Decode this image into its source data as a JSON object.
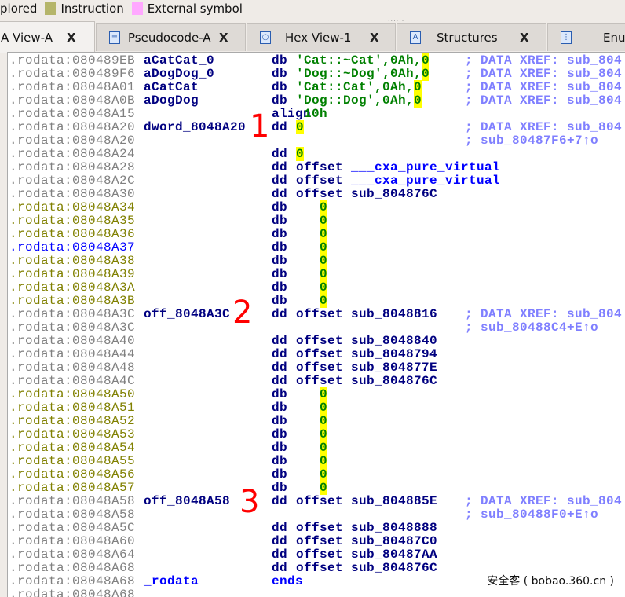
{
  "legend": [
    {
      "label": "plored",
      "color": ""
    },
    {
      "label": "Instruction",
      "color": "#b5b56a"
    },
    {
      "label": "External symbol",
      "color": "#ffa8ff"
    }
  ],
  "tabs": [
    {
      "label": "A View-A",
      "icon": "",
      "active": true
    },
    {
      "label": "Pseudocode-A",
      "icon": "pseudocode-icon"
    },
    {
      "label": "Hex View-1",
      "icon": "hex-icon"
    },
    {
      "label": "Structures",
      "icon": "structures-icon"
    },
    {
      "label": "Enur",
      "icon": "enums-icon"
    }
  ],
  "close_glyph": "X",
  "rows": [
    {
      "addr": ".rodata:080489EB",
      "ac": "gray",
      "label": "aCatCat_0",
      "mn": "db",
      "op": [
        [
          "'Cat::~Cat'",
          "s"
        ],
        [
          ",0Ah,",
          "s"
        ],
        [
          "0",
          "hl"
        ]
      ],
      "cm": "; DATA XREF: sub_804"
    },
    {
      "addr": ".rodata:080489F6",
      "ac": "gray",
      "label": "aDogDog_0",
      "mn": "db",
      "op": [
        [
          "'Dog::~Dog'",
          "s"
        ],
        [
          ",0Ah,",
          "s"
        ],
        [
          "0",
          "hl"
        ]
      ],
      "cm": "; DATA XREF: sub_804"
    },
    {
      "addr": ".rodata:08048A01",
      "ac": "gray",
      "label": "aCatCat",
      "mn": "db",
      "op": [
        [
          "'Cat::Cat'",
          "s"
        ],
        [
          ",0Ah,",
          "s"
        ],
        [
          "0",
          "hl"
        ]
      ],
      "cm": "; DATA XREF: sub_804"
    },
    {
      "addr": ".rodata:08048A0B",
      "ac": "gray",
      "label": "aDogDog",
      "mn": "db",
      "op": [
        [
          "'Dog::Dog'",
          "s"
        ],
        [
          ",0Ah,",
          "s"
        ],
        [
          "0",
          "hl"
        ]
      ],
      "cm": "; DATA XREF: sub_804"
    },
    {
      "addr": ".rodata:08048A15",
      "ac": "gray",
      "label": "",
      "mn": "align",
      "op": [
        [
          " 10h",
          "n"
        ]
      ],
      "cm": ""
    },
    {
      "addr": ".rodata:08048A20",
      "ac": "gray",
      "label": "dword_8048A20",
      "mn": "dd",
      "op": [
        [
          "0",
          "hl"
        ]
      ],
      "cm": "; DATA XREF: sub_804"
    },
    {
      "addr": ".rodata:08048A20",
      "ac": "gray",
      "label": "",
      "mn": "",
      "op": [],
      "cm": "; sub_80487F6+7↑o"
    },
    {
      "addr": ".rodata:08048A24",
      "ac": "gray",
      "label": "",
      "mn": "dd",
      "op": [
        [
          "0",
          "hl"
        ]
      ],
      "cm": ""
    },
    {
      "addr": ".rodata:08048A28",
      "ac": "gray",
      "label": "",
      "mn": "dd",
      "op": [
        [
          "offset ",
          "o"
        ],
        [
          "___cxa_pure_virtual",
          "e"
        ]
      ],
      "cm": ""
    },
    {
      "addr": ".rodata:08048A2C",
      "ac": "gray",
      "label": "",
      "mn": "dd",
      "op": [
        [
          "offset ",
          "o"
        ],
        [
          "___cxa_pure_virtual",
          "e"
        ]
      ],
      "cm": ""
    },
    {
      "addr": ".rodata:08048A30",
      "ac": "gray",
      "label": "",
      "mn": "dd",
      "op": [
        [
          "offset sub_804876C",
          "o"
        ]
      ],
      "cm": ""
    },
    {
      "addr": ".rodata:08048A34",
      "ac": "olive",
      "label": "",
      "mn": "db",
      "op": [
        [
          "   ",
          "o"
        ],
        [
          "0",
          "hl"
        ]
      ],
      "cm": ""
    },
    {
      "addr": ".rodata:08048A35",
      "ac": "olive",
      "label": "",
      "mn": "db",
      "op": [
        [
          "   ",
          "o"
        ],
        [
          "0",
          "hl"
        ]
      ],
      "cm": ""
    },
    {
      "addr": ".rodata:08048A36",
      "ac": "olive",
      "label": "",
      "mn": "db",
      "op": [
        [
          "   ",
          "o"
        ],
        [
          "0",
          "hl"
        ]
      ],
      "cm": ""
    },
    {
      "addr": ".rodata:08048A37",
      "ac": "blue",
      "label": "",
      "mn": "db",
      "op": [
        [
          "   ",
          "o"
        ],
        [
          "0",
          "hl"
        ]
      ],
      "cm": ""
    },
    {
      "addr": ".rodata:08048A38",
      "ac": "olive",
      "label": "",
      "mn": "db",
      "op": [
        [
          "   ",
          "o"
        ],
        [
          "0",
          "hl"
        ]
      ],
      "cm": ""
    },
    {
      "addr": ".rodata:08048A39",
      "ac": "olive",
      "label": "",
      "mn": "db",
      "op": [
        [
          "   ",
          "o"
        ],
        [
          "0",
          "hl"
        ]
      ],
      "cm": ""
    },
    {
      "addr": ".rodata:08048A3A",
      "ac": "olive",
      "label": "",
      "mn": "db",
      "op": [
        [
          "   ",
          "o"
        ],
        [
          "0",
          "hl"
        ]
      ],
      "cm": ""
    },
    {
      "addr": ".rodata:08048A3B",
      "ac": "olive",
      "label": "",
      "mn": "db",
      "op": [
        [
          "   ",
          "o"
        ],
        [
          "0",
          "hl"
        ]
      ],
      "cm": ""
    },
    {
      "addr": ".rodata:08048A3C",
      "ac": "gray",
      "label": "off_8048A3C",
      "mn": "dd",
      "op": [
        [
          "offset sub_8048816",
          "o"
        ]
      ],
      "cm": "; DATA XREF: sub_804"
    },
    {
      "addr": ".rodata:08048A3C",
      "ac": "gray",
      "label": "",
      "mn": "",
      "op": [],
      "cm": "; sub_80488C4+E↑o"
    },
    {
      "addr": ".rodata:08048A40",
      "ac": "gray",
      "label": "",
      "mn": "dd",
      "op": [
        [
          "offset sub_8048840",
          "o"
        ]
      ],
      "cm": ""
    },
    {
      "addr": ".rodata:08048A44",
      "ac": "gray",
      "label": "",
      "mn": "dd",
      "op": [
        [
          "offset sub_8048794",
          "o"
        ]
      ],
      "cm": ""
    },
    {
      "addr": ".rodata:08048A48",
      "ac": "gray",
      "label": "",
      "mn": "dd",
      "op": [
        [
          "offset sub_804877E",
          "o"
        ]
      ],
      "cm": ""
    },
    {
      "addr": ".rodata:08048A4C",
      "ac": "gray",
      "label": "",
      "mn": "dd",
      "op": [
        [
          "offset sub_804876C",
          "o"
        ]
      ],
      "cm": ""
    },
    {
      "addr": ".rodata:08048A50",
      "ac": "olive",
      "label": "",
      "mn": "db",
      "op": [
        [
          "   ",
          "o"
        ],
        [
          "0",
          "hl"
        ]
      ],
      "cm": ""
    },
    {
      "addr": ".rodata:08048A51",
      "ac": "olive",
      "label": "",
      "mn": "db",
      "op": [
        [
          "   ",
          "o"
        ],
        [
          "0",
          "hl"
        ]
      ],
      "cm": ""
    },
    {
      "addr": ".rodata:08048A52",
      "ac": "olive",
      "label": "",
      "mn": "db",
      "op": [
        [
          "   ",
          "o"
        ],
        [
          "0",
          "hl"
        ]
      ],
      "cm": ""
    },
    {
      "addr": ".rodata:08048A53",
      "ac": "olive",
      "label": "",
      "mn": "db",
      "op": [
        [
          "   ",
          "o"
        ],
        [
          "0",
          "hl"
        ]
      ],
      "cm": ""
    },
    {
      "addr": ".rodata:08048A54",
      "ac": "olive",
      "label": "",
      "mn": "db",
      "op": [
        [
          "   ",
          "o"
        ],
        [
          "0",
          "hl"
        ]
      ],
      "cm": ""
    },
    {
      "addr": ".rodata:08048A55",
      "ac": "olive",
      "label": "",
      "mn": "db",
      "op": [
        [
          "   ",
          "o"
        ],
        [
          "0",
          "hl"
        ]
      ],
      "cm": ""
    },
    {
      "addr": ".rodata:08048A56",
      "ac": "olive",
      "label": "",
      "mn": "db",
      "op": [
        [
          "   ",
          "o"
        ],
        [
          "0",
          "hl"
        ]
      ],
      "cm": ""
    },
    {
      "addr": ".rodata:08048A57",
      "ac": "olive",
      "label": "",
      "mn": "db",
      "op": [
        [
          "   ",
          "o"
        ],
        [
          "0",
          "hl"
        ]
      ],
      "cm": ""
    },
    {
      "addr": ".rodata:08048A58",
      "ac": "gray",
      "label": "off_8048A58",
      "mn": "dd",
      "op": [
        [
          "offset sub_804885E",
          "o"
        ]
      ],
      "cm": "; DATA XREF: sub_804"
    },
    {
      "addr": ".rodata:08048A58",
      "ac": "gray",
      "label": "",
      "mn": "",
      "op": [],
      "cm": "; sub_80488F0+E↑o"
    },
    {
      "addr": ".rodata:08048A5C",
      "ac": "gray",
      "label": "",
      "mn": "dd",
      "op": [
        [
          "offset sub_8048888",
          "o"
        ]
      ],
      "cm": ""
    },
    {
      "addr": ".rodata:08048A60",
      "ac": "gray",
      "label": "",
      "mn": "dd",
      "op": [
        [
          "offset sub_80487C0",
          "o"
        ]
      ],
      "cm": ""
    },
    {
      "addr": ".rodata:08048A64",
      "ac": "gray",
      "label": "",
      "mn": "dd",
      "op": [
        [
          "offset sub_80487AA",
          "o"
        ]
      ],
      "cm": ""
    },
    {
      "addr": ".rodata:08048A68",
      "ac": "gray",
      "label": "",
      "mn": "dd",
      "op": [
        [
          "offset sub_804876C",
          "o"
        ]
      ],
      "cm": ""
    },
    {
      "addr": ".rodata:08048A68",
      "ac": "gray",
      "label": "_rodata",
      "mn": "ends",
      "op": [],
      "cm": "",
      "ext": true
    },
    {
      "addr": ".rodata:08048A68",
      "ac": "gray",
      "label": "",
      "mn": "",
      "op": [],
      "cm": ""
    }
  ],
  "markers": [
    "1",
    "2",
    "3"
  ],
  "watermark": "安全客 ( bobao.360.cn )"
}
